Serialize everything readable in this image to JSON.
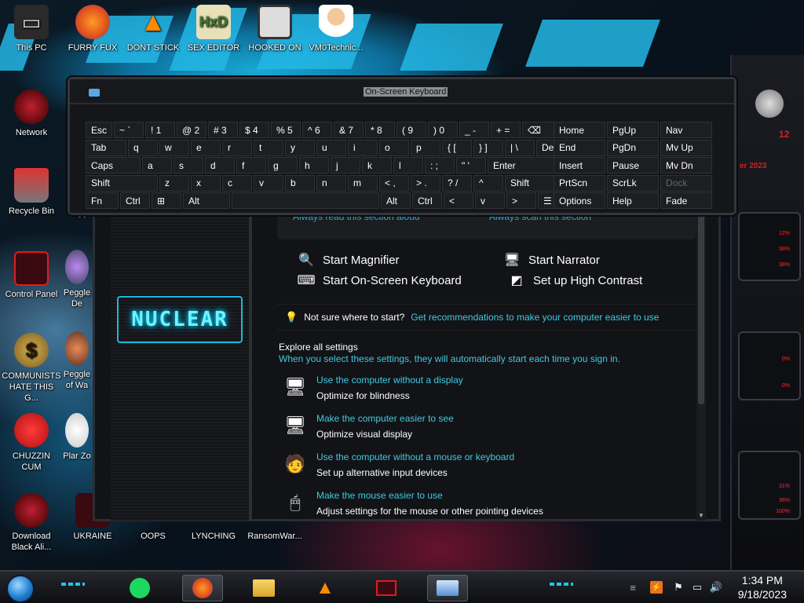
{
  "desktop": {
    "icons": [
      {
        "label": "This PC",
        "icon": "computer-icon"
      },
      {
        "label": "FURRY FUX",
        "icon": "firefox-icon"
      },
      {
        "label": "DONT STICK",
        "icon": "vlc-icon"
      },
      {
        "label": "SEX EDITOR",
        "icon": "hxd-icon"
      },
      {
        "label": "HOOKED ON",
        "icon": "app-icon"
      },
      {
        "label": "VM0Technic...",
        "icon": "doctor-icon"
      },
      {
        "label": "Network",
        "icon": "network-icon"
      },
      {
        "label": "Recycle Bin",
        "icon": "recycle-bin-icon"
      },
      {
        "label": "Control Panel",
        "icon": "control-panel-icon"
      },
      {
        "label": "COMMUNISTS HATE THIS G...",
        "icon": "money-bag-icon"
      },
      {
        "label": "CHUZZIN CUM",
        "icon": "chuzzle-icon"
      },
      {
        "label": "Download Black Ali...",
        "icon": "alien-icon"
      },
      {
        "label": "UKRAINE",
        "icon": "app-icon"
      },
      {
        "label": "OOPS",
        "icon": "app-icon"
      },
      {
        "label": "LYNCHING",
        "icon": "app-icon"
      },
      {
        "label": "RansomWar...",
        "icon": "app-icon"
      },
      {
        "label": "Pegg",
        "icon": "peggle-icon"
      },
      {
        "label": "Peggle De",
        "icon": "peggle-icon"
      },
      {
        "label": "Peggle of Wa",
        "icon": "peggle-icon"
      },
      {
        "label": "Plar Zo",
        "icon": "plants-icon"
      }
    ]
  },
  "side_panel": {
    "red_top": "12",
    "red_date": "er 2023",
    "pcts": [
      "12%",
      "38%",
      "38%",
      "0%",
      "0%",
      "31%",
      "38%",
      "100%"
    ]
  },
  "osk": {
    "title": "On-Screen Keyboard",
    "rows": [
      [
        "Esc",
        "~ `",
        "! 1",
        "@ 2",
        "# 3",
        "$ 4",
        "% 5",
        "^ 6",
        "& 7",
        "* 8",
        "( 9",
        ") 0",
        "_ -",
        "+ =",
        "⌫",
        "Home",
        "PgUp",
        "Nav"
      ],
      [
        "Tab",
        "q",
        "w",
        "e",
        "r",
        "t",
        "y",
        "u",
        "i",
        "o",
        "p",
        "{ [",
        "} ]",
        "| \\",
        "Del",
        "End",
        "PgDn",
        "Mv Up"
      ],
      [
        "Caps",
        "a",
        "s",
        "d",
        "f",
        "g",
        "h",
        "j",
        "k",
        "l",
        ": ;",
        "\" '",
        "Enter",
        "Insert",
        "Pause",
        "Mv Dn"
      ],
      [
        "Shift",
        "z",
        "x",
        "c",
        "v",
        "b",
        "n",
        "m",
        "< ,",
        "> .",
        "? /",
        "^",
        "Shift",
        "PrtScn",
        "ScrLk",
        "Dock"
      ],
      [
        "Fn",
        "Ctrl",
        "⊞",
        "Alt",
        "",
        "Alt",
        "Ctrl",
        "<",
        "v",
        ">",
        "☰",
        "Options",
        "Help",
        "Fade"
      ]
    ]
  },
  "control_panel": {
    "cut_links": [
      "Always read this section aloud",
      "Always scan this section"
    ],
    "quick_tools": [
      {
        "label": "Start Magnifier",
        "icon": "magnifier-icon"
      },
      {
        "label": "Start Narrator",
        "icon": "narrator-icon"
      },
      {
        "label": "Start On-Screen Keyboard",
        "icon": "keyboard-icon"
      },
      {
        "label": "Set up High Contrast",
        "icon": "contrast-icon"
      }
    ],
    "hint_text": "Not sure where to start?",
    "hint_link": "Get recommendations to make your computer easier to use",
    "explore_title": "Explore all settings",
    "explore_sub": "When you select these settings, they will automatically start each time you sign in.",
    "settings": [
      {
        "link": "Use the computer without a display",
        "desc": "Optimize for blindness",
        "icon": "display-off-icon"
      },
      {
        "link": "Make the computer easier to see",
        "desc": "Optimize visual display",
        "icon": "monitor-icon"
      },
      {
        "link": "Use the computer without a mouse or keyboard",
        "desc": "Set up alternative input devices",
        "icon": "person-input-icon"
      },
      {
        "link": "Make the mouse easier to use",
        "desc": "Adjust settings for the mouse or other pointing devices",
        "icon": "mouse-icon"
      }
    ],
    "logo_text": "NUCLEAR"
  },
  "taskbar": {
    "time": "1:34 PM",
    "date": "9/18/2023"
  },
  "colors": {
    "accent_cyan": "#3fc9e3",
    "window_bg": "#121316",
    "alert_red": "#e21b1b"
  }
}
